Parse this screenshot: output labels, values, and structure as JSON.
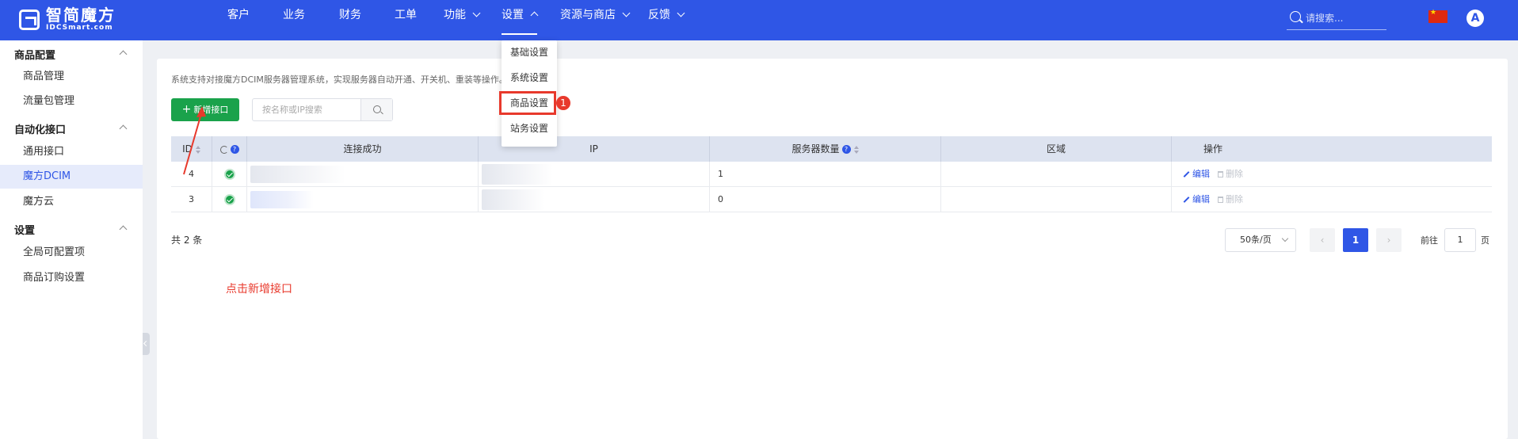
{
  "brand": {
    "name_cn": "智简魔方",
    "name_en": "IDCSmart.com"
  },
  "nav": {
    "items": [
      {
        "label": "客户"
      },
      {
        "label": "业务"
      },
      {
        "label": "财务"
      },
      {
        "label": "工单"
      },
      {
        "label": "功能"
      },
      {
        "label": "设置"
      },
      {
        "label": "资源与商店"
      },
      {
        "label": "反馈"
      }
    ],
    "search_placeholder": "请搜索...",
    "avatar_letter": "A"
  },
  "sidebar": {
    "groups": [
      {
        "label": "商品配置",
        "items": [
          {
            "label": "商品管理"
          },
          {
            "label": "流量包管理"
          }
        ]
      },
      {
        "label": "自动化接口",
        "items": [
          {
            "label": "通用接口"
          },
          {
            "label": "魔方DCIM"
          },
          {
            "label": "魔方云"
          }
        ]
      },
      {
        "label": "设置",
        "items": [
          {
            "label": "全局可配置项"
          },
          {
            "label": "商品订购设置"
          }
        ]
      }
    ]
  },
  "settings_menu": {
    "items": [
      {
        "label": "基础设置"
      },
      {
        "label": "系统设置"
      },
      {
        "label": "商品设置"
      },
      {
        "label": "站务设置"
      }
    ],
    "highlight_badge": "1"
  },
  "main": {
    "description": "系统支持对接魔方DCIM服务器管理系统，实现服务器自动开通、开关机、重装等操作。",
    "add_button": "新增接口",
    "search_placeholder": "按名称或IP搜索",
    "table": {
      "headers": {
        "id": "ID",
        "status": "连接成功",
        "ip": "IP",
        "server_count": "服务器数量",
        "region": "区域",
        "actions": "操作"
      },
      "rows": [
        {
          "id": "4",
          "server_count": "1",
          "region": ""
        },
        {
          "id": "3",
          "server_count": "0",
          "region": ""
        }
      ],
      "edit_label": "编辑",
      "delete_label": "删除"
    },
    "total": "共 2 条",
    "pagination": {
      "page_size": "50条/页",
      "prev": "‹",
      "current": "1",
      "next": "›",
      "goto_label": "前往",
      "goto_value": "1",
      "page_suffix": "页"
    }
  },
  "annotation": {
    "note": "点击新增接口"
  },
  "colors": {
    "primary": "#2f56e6",
    "success": "#1aa24b",
    "annotation_red": "#e8392c"
  }
}
